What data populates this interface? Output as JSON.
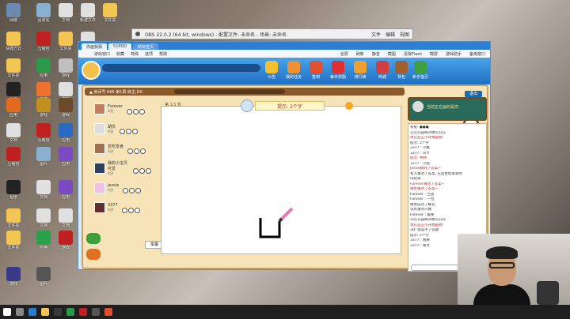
{
  "desktop": {
    "icons": [
      {
        "label": "网络",
        "color": "#6a8ab0"
      },
      {
        "label": "回收站",
        "color": "#8ab0d0"
      },
      {
        "label": "文档",
        "color": "#e0e0e0"
      },
      {
        "label": "新建文件",
        "color": "#e0e0e0"
      },
      {
        "label": "文件夹",
        "color": "#f3c552"
      },
      {
        "label": "快捷方式",
        "color": "#f3c552"
      },
      {
        "label": "压缩包",
        "color": "#c02020"
      },
      {
        "label": "文件夹",
        "color": "#f3c552"
      },
      {
        "label": "文档",
        "color": "#e0e0e0"
      },
      {
        "label": "文件夹",
        "color": "#f3c552"
      },
      {
        "label": "应用",
        "color": "#2a9a4a"
      },
      {
        "label": "游戏",
        "color": "#c0c0c0"
      },
      {
        "label": "文件夹",
        "color": "#f3c552"
      },
      {
        "label": "程序",
        "color": "#222222"
      },
      {
        "label": "应用",
        "color": "#f07030"
      },
      {
        "label": "文档",
        "color": "#e0e0e0"
      },
      {
        "label": "应用",
        "color": "#e06a20"
      },
      {
        "label": "游戏",
        "color": "#c09020"
      },
      {
        "label": "游戏",
        "color": "#6a4a2a"
      },
      {
        "label": "文档",
        "color": "#e0e0e0"
      },
      {
        "label": "压缩包",
        "color": "#c02020"
      },
      {
        "label": "应用",
        "color": "#2a6ac0"
      },
      {
        "label": "压缩包",
        "color": "#c02020"
      },
      {
        "label": "图片",
        "color": "#8ab0d0"
      },
      {
        "label": "应用",
        "color": "#7a4ac0"
      },
      {
        "label": "程序",
        "color": "#222222"
      },
      {
        "label": "文档",
        "color": "#e0e0e0"
      },
      {
        "label": "应用",
        "color": "#7a4ac0"
      },
      {
        "label": "文件夹",
        "color": "#f3c552"
      },
      {
        "label": "文档",
        "color": "#e0e0e0"
      },
      {
        "label": "文档",
        "color": "#e0e0e0"
      },
      {
        "label": "文件夹",
        "color": "#f3c552"
      },
      {
        "label": "应用",
        "color": "#2aa04a"
      },
      {
        "label": "游戏",
        "color": "#c02020"
      },
      {
        "label": "游戏",
        "color": "#3a3a8a"
      },
      {
        "label": "图片",
        "color": "#555555"
      }
    ]
  },
  "obs": {
    "title": "OBS 22.0.2 (64 bit, windows) - 配置文件: 未命名 - 场景: 未命名",
    "items": [
      "文件",
      "编辑",
      "视图"
    ]
  },
  "browser": {
    "tabs": [
      "你画我猜",
      "51PDD",
      "新标签页"
    ],
    "menu": [
      "游戏窗口",
      "收藏",
      "特殊",
      "选项",
      "帮助"
    ],
    "right_menu": [
      "全屏",
      "刷新",
      "静音",
      "截图",
      "清除Flash",
      "截屏",
      "游戏助手",
      "备用窗口"
    ]
  },
  "game": {
    "head_buttons": [
      "公告",
      "我的任务",
      "签到",
      "每日奖励",
      "排行榜",
      "商城",
      "背包",
      "新手指引"
    ],
    "room_label": "▲ 房间号 666  第1局 房主:DX",
    "round_label": "第 1/1 轮",
    "hint": "提示: 2个字",
    "timer": "51",
    "report_label": "举报",
    "players": [
      {
        "name": "Forever",
        "score": "4分",
        "color": "#c08060"
      },
      {
        "name": "胡优",
        "score": "4分",
        "color": "#dddddd"
      },
      {
        "name": "爱吃零食",
        "score": "4分",
        "color": "#a07050"
      },
      {
        "name": "我的小宝贝可爱",
        "score": "4分",
        "color": "#304060"
      },
      {
        "name": "jessie",
        "score": "4分",
        "color": "#f0c0e0"
      },
      {
        "name": "3377",
        "score": "4分",
        "color": "#603030"
      }
    ],
    "side_tab": "退出",
    "side_msg": "当前正在画的是你",
    "chat": [
      {
        "t": "系统: ●●●",
        "red": false
      },
      {
        "t": "公公公园目开始公公公",
        "red": false
      },
      {
        "t": "现在是王小开始画啦!",
        "red": true
      },
      {
        "t": "提示: 2个字",
        "red": false
      },
      {
        "t": "3377 : 小鹰",
        "red": false
      },
      {
        "t": "3377 : 鸟卡",
        "red": false
      },
      {
        "t": "提示: 鸭鸭",
        "red": true
      },
      {
        "t": "3377 : 小钻",
        "red": false
      },
      {
        "t": "Jessie猜对了答案~",
        "red": true
      },
      {
        "t": "有人猜对了答案, 在回合结束到时",
        "red": false
      },
      {
        "t": "内结束",
        "red": false
      },
      {
        "t": "Forever猜对了答案~",
        "red": true
      },
      {
        "t": "胡优猜对了答案~",
        "red": true
      },
      {
        "t": "Forever : 兰盖",
        "red": false
      },
      {
        "t": "Forever : 一位",
        "red": false
      },
      {
        "t": "胡优成功了解答",
        "red": false
      },
      {
        "t": "没有猜对人数",
        "red": false
      },
      {
        "t": "Forever : 最果",
        "red": false
      },
      {
        "t": "公公公园目开始公公公",
        "red": false
      },
      {
        "t": "现在是王小开始画啦!",
        "red": true
      },
      {
        "t": "3D: 就是不了答疑",
        "red": false
      },
      {
        "t": "提示: 2个字",
        "red": false
      },
      {
        "t": "3377 : 两果",
        "red": false
      },
      {
        "t": "3377 : 果大",
        "red": false
      }
    ]
  }
}
